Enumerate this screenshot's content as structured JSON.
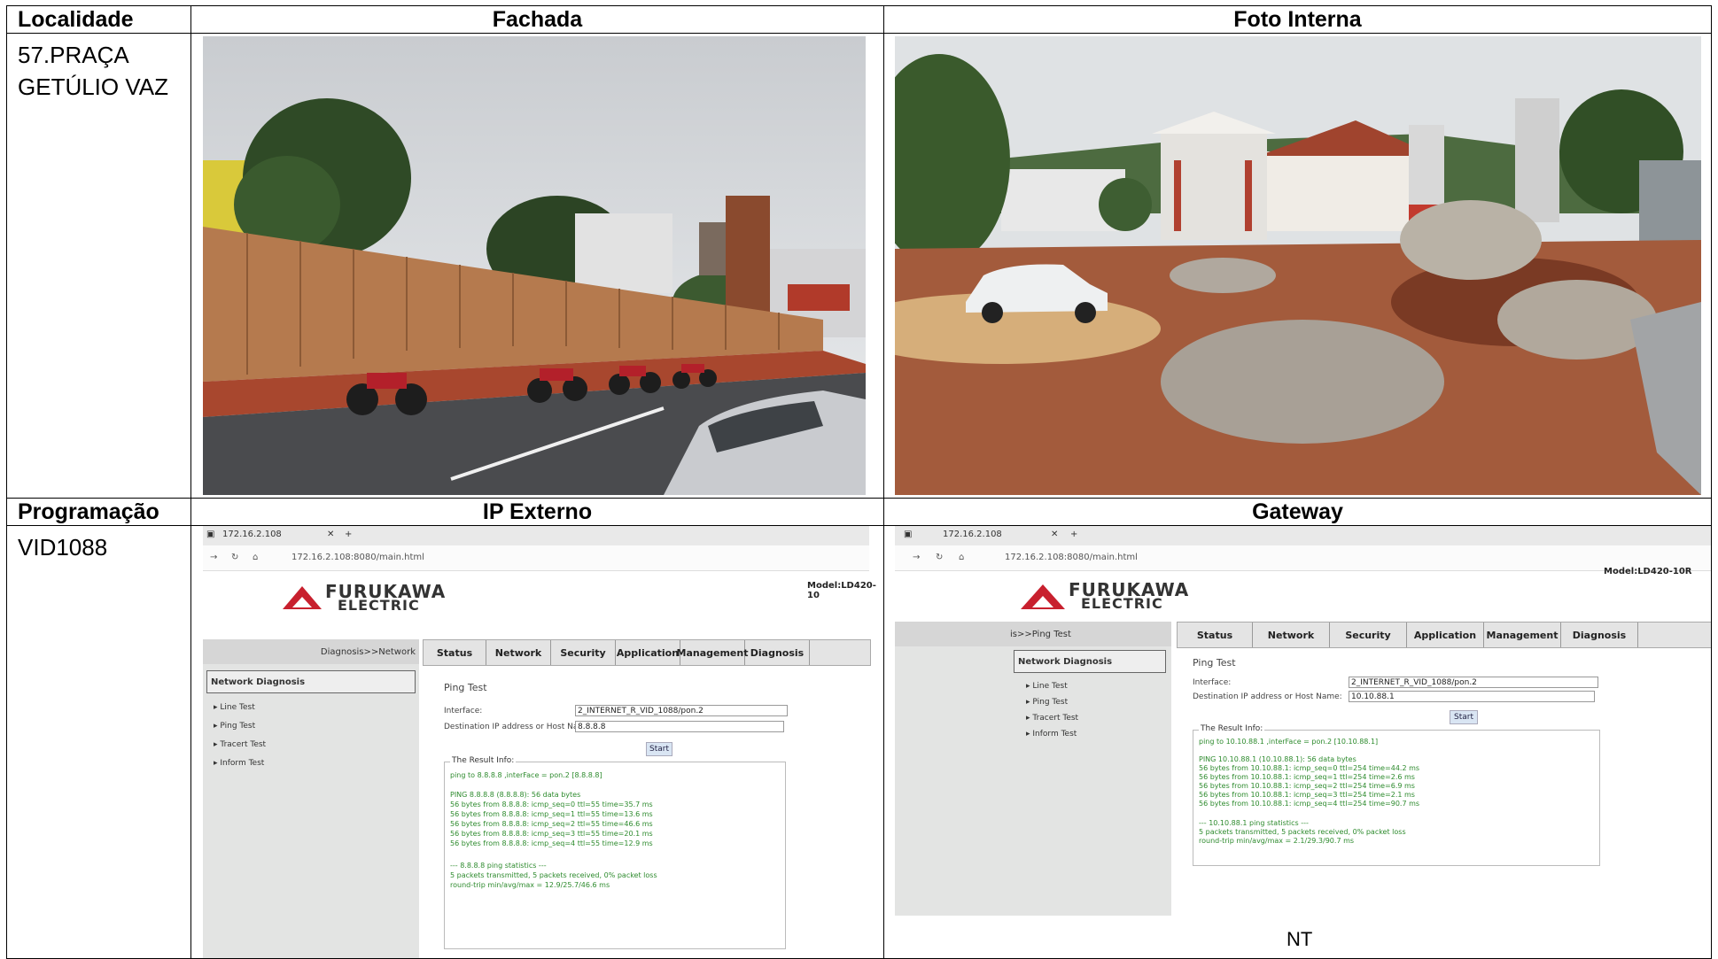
{
  "headers_top": {
    "col1": "Localidade",
    "col2": "Fachada",
    "col3": "Foto Interna"
  },
  "localidade": [
    "57.PRAÇA",
    "GETÚLIO VAZ"
  ],
  "headers_bottom": {
    "col1": "Programação",
    "col2": "IP Externo",
    "col3": "Gateway"
  },
  "programacao": "VID1088",
  "gateway_note": "NT",
  "ip_externo_shot": {
    "tab_title": "172.16.2.108",
    "url": "172.16.2.108:8080/main.html",
    "logo_line1": "FURUKAWA",
    "logo_line2": "ELECTRIC",
    "model": "Model:LD420-10",
    "breadcrumb": "Diagnosis>>Network",
    "nav": [
      "Status",
      "Network",
      "Security",
      "Application",
      "Management",
      "Diagnosis"
    ],
    "side_title": "Network Diagnosis",
    "side_items": [
      "Line Test",
      "Ping Test",
      "Tracert Test",
      "Inform Test"
    ],
    "page_title": "Ping Test",
    "interface_label": "Interface:",
    "interface_value": "2_INTERNET_R_VID_1088/pon.2",
    "dest_label": "Destination IP address or Host Name:",
    "dest_value": "8.8.8.8",
    "start": "Start",
    "result_title": "The Result Info:",
    "result_lines": [
      "ping to 8.8.8.8 ,interFace = pon.2 [8.8.8.8]",
      "PING 8.8.8.8 (8.8.8.8): 56 data bytes",
      "56 bytes from 8.8.8.8: icmp_seq=0 ttl=55 time=35.7 ms",
      "56 bytes from 8.8.8.8: icmp_seq=1 ttl=55 time=13.6 ms",
      "56 bytes from 8.8.8.8: icmp_seq=2 ttl=55 time=46.6 ms",
      "56 bytes from 8.8.8.8: icmp_seq=3 ttl=55 time=20.1 ms",
      "56 bytes from 8.8.8.8: icmp_seq=4 ttl=55 time=12.9 ms",
      "--- 8.8.8.8 ping statistics ---",
      "5 packets transmitted, 5 packets received, 0% packet loss",
      "round-trip min/avg/max = 12.9/25.7/46.6 ms"
    ]
  },
  "gateway_shot": {
    "tab_title": "172.16.2.108",
    "url": "172.16.2.108:8080/main.html",
    "logo_line1": "FURUKAWA",
    "logo_line2": "ELECTRIC",
    "model": "Model:LD420-10R",
    "breadcrumb": "is>>Ping Test",
    "nav": [
      "Status",
      "Network",
      "Security",
      "Application",
      "Management",
      "Diagnosis"
    ],
    "side_title": "Network Diagnosis",
    "side_items": [
      "Line Test",
      "Ping Test",
      "Tracert Test",
      "Inform Test"
    ],
    "page_title": "Ping Test",
    "interface_label": "Interface:",
    "interface_value": "2_INTERNET_R_VID_1088/pon.2",
    "dest_label": "Destination IP address or Host Name:",
    "dest_value": "10.10.88.1",
    "start": "Start",
    "result_title": "The Result Info:",
    "result_lines": [
      "ping to 10.10.88.1 ,interFace = pon.2 [10.10.88.1]",
      "PING 10.10.88.1 (10.10.88.1): 56 data bytes",
      "56 bytes from 10.10.88.1: icmp_seq=0 ttl=254 time=44.2 ms",
      "56 bytes from 10.10.88.1: icmp_seq=1 ttl=254 time=2.6 ms",
      "56 bytes from 10.10.88.1: icmp_seq=2 ttl=254 time=6.9 ms",
      "56 bytes from 10.10.88.1: icmp_seq=3 ttl=254 time=2.1 ms",
      "56 bytes from 10.10.88.1: icmp_seq=4 ttl=254 time=90.7 ms",
      "--- 10.10.88.1 ping statistics ---",
      "5 packets transmitted, 5 packets received, 0% packet loss",
      "round-trip min/avg/max = 2.1/29.3/90.7 ms"
    ]
  }
}
